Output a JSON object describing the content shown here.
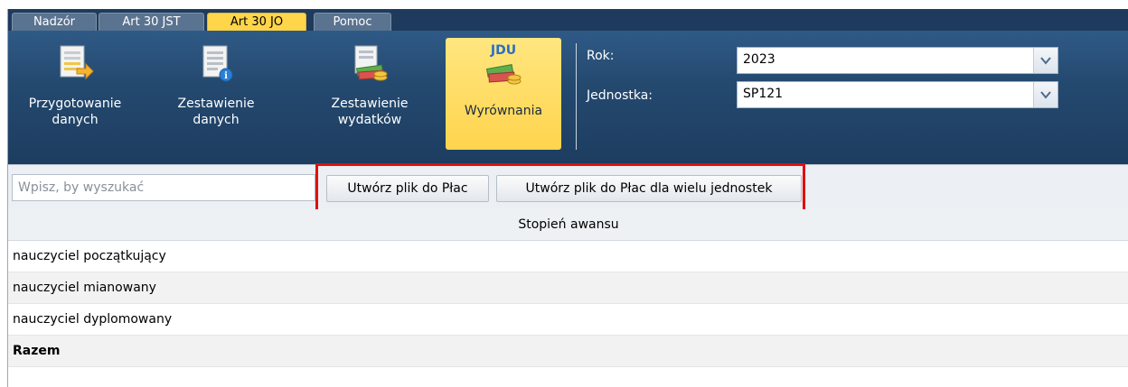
{
  "tabs": [
    {
      "label": "Nadzór",
      "active": false
    },
    {
      "label": "Art 30 JST",
      "active": false
    },
    {
      "label": "Art 30 JO",
      "active": true
    },
    {
      "label": "Pomoc",
      "active": false
    }
  ],
  "ribbon": {
    "buttons": [
      {
        "label_line1": "Przygotowanie",
        "label_line2": "danych",
        "icon": "document-arrow-icon"
      },
      {
        "label_line1": "Zestawienie",
        "label_line2": "danych",
        "icon": "document-info-icon"
      },
      {
        "label_line1": "Zestawienie",
        "label_line2": "wydatków",
        "icon": "money-document-icon"
      },
      {
        "label_line1": "Wyrównania",
        "label_line2": "",
        "icon": "money-jdu-icon",
        "badge": "JDU",
        "active": true
      }
    ],
    "rok_label": "Rok:",
    "rok_value": "2023",
    "jednostka_label": "Jednostka:",
    "jednostka_value": "SP121"
  },
  "toolbar": {
    "search_placeholder": "Wpisz, by wyszukać",
    "btn_create": "Utwórz plik do Płac",
    "btn_create_many": "Utwórz plik do Płac dla wielu jednostek"
  },
  "grid": {
    "header": "Stopień awansu",
    "rows": [
      "nauczyciel początkujący",
      "nauczyciel mianowany",
      "nauczyciel dyplomowany"
    ],
    "total": "Razem"
  },
  "colors": {
    "accent": "#ffd54a",
    "ribbon": "#24496f",
    "highlight": "#e01010"
  }
}
